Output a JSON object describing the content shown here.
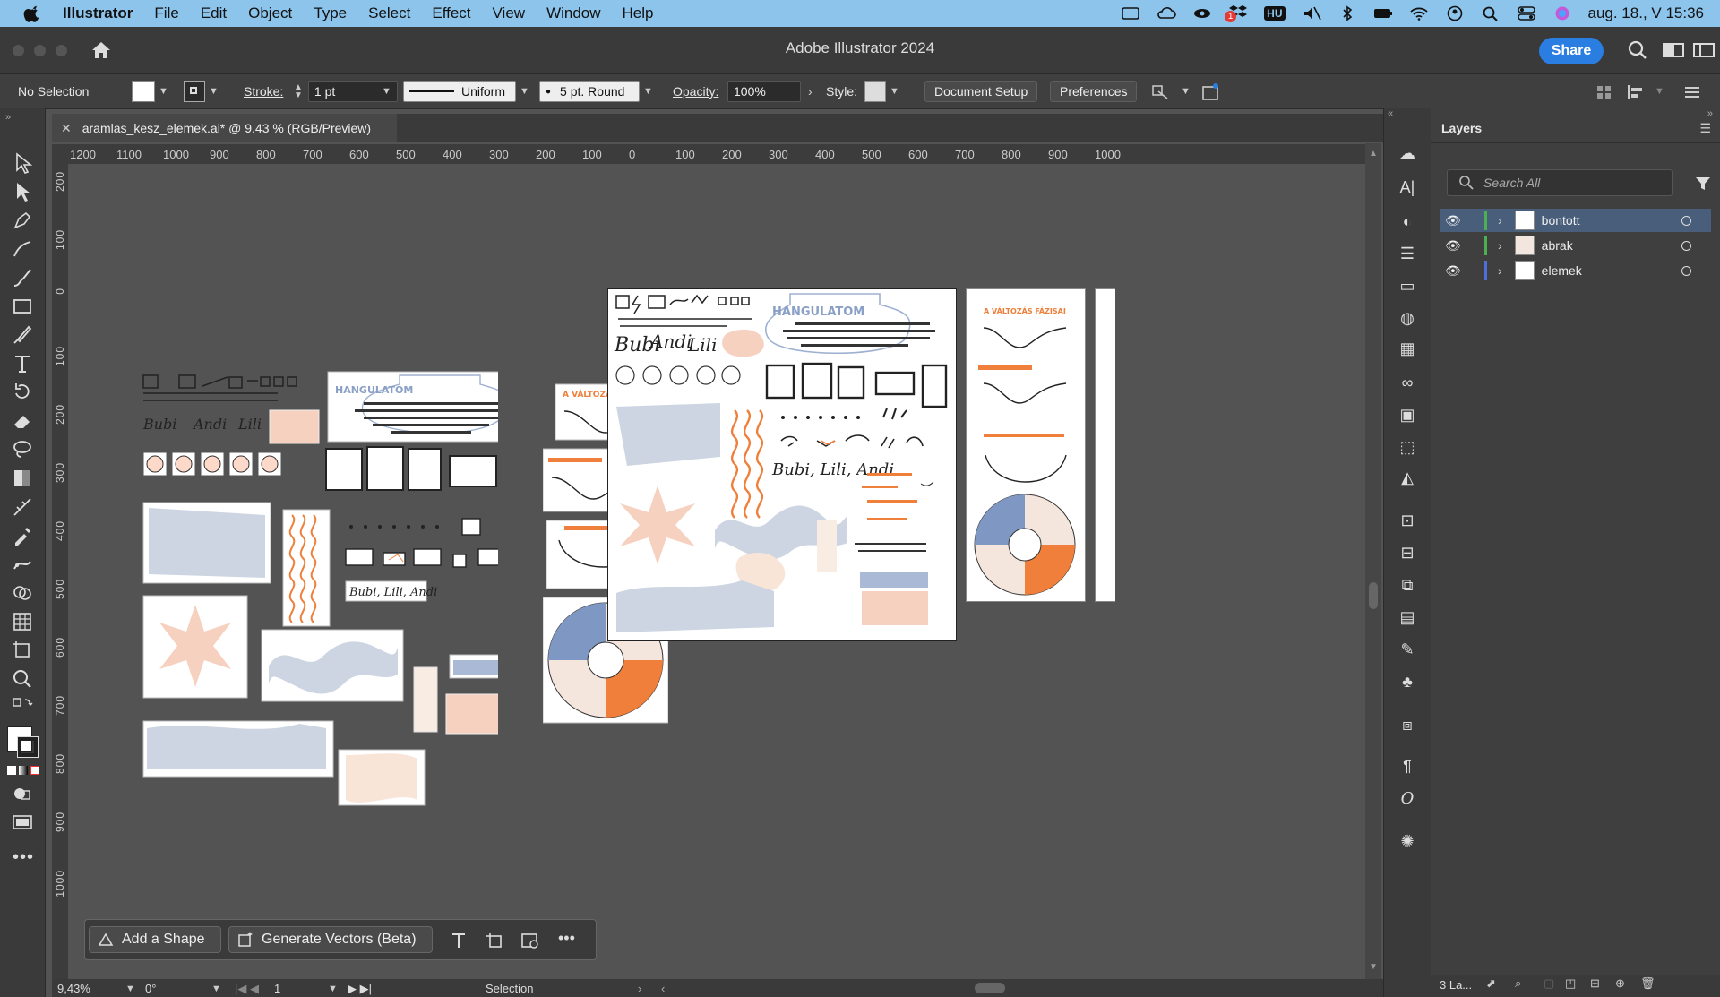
{
  "menubar": {
    "app_name": "Illustrator",
    "items": [
      "File",
      "Edit",
      "Object",
      "Type",
      "Select",
      "Effect",
      "View",
      "Window",
      "Help"
    ],
    "lang_badge": "HU",
    "notification_count": "1",
    "clock": "aug. 18., V  15:36"
  },
  "titlebar": {
    "title": "Adobe Illustrator 2024",
    "share_label": "Share"
  },
  "controlbar": {
    "selection": "No Selection",
    "stroke_label": "Stroke:",
    "stroke_value": "1 pt",
    "profile": "Uniform",
    "brush": "5 pt. Round",
    "opacity_label": "Opacity:",
    "opacity_value": "100%",
    "style_label": "Style:",
    "document_setup": "Document Setup",
    "preferences": "Preferences"
  },
  "document_tab": {
    "label": "aramlas_kesz_elemek.ai* @ 9.43 % (RGB/Preview)"
  },
  "rulers": {
    "horizontal": [
      "1200",
      "1100",
      "1000",
      "900",
      "800",
      "700",
      "600",
      "500",
      "400",
      "300",
      "200",
      "100",
      "0",
      "100",
      "200",
      "300",
      "400",
      "500",
      "600",
      "700",
      "800",
      "900",
      "1000"
    ],
    "vertical": [
      "200",
      "100",
      "0",
      "100",
      "200",
      "300",
      "400",
      "500",
      "600",
      "700",
      "800",
      "900",
      "1000"
    ]
  },
  "canvas": {
    "artboard_text": {
      "hangulatom": "HANGULATOM",
      "valtozas": "A VÁLTOZÁS FÁZISAI",
      "signature": "Bubi, Lili, Andi"
    }
  },
  "layers_panel": {
    "title": "Layers",
    "search_placeholder": "Search All",
    "layers": [
      {
        "name": "bontott",
        "color": "#4caf50",
        "selected": true
      },
      {
        "name": "abrak",
        "color": "#4caf50",
        "selected": false
      },
      {
        "name": "elemek",
        "color": "#4f6fd8",
        "selected": false
      }
    ],
    "count_label": "3 La..."
  },
  "statusbar": {
    "zoom": "9,43%",
    "rotation": "0°",
    "artboard_number": "1",
    "tool_name": "Selection"
  },
  "context_bar": {
    "add_shape": "Add a Shape",
    "generate_vectors": "Generate Vectors (Beta)"
  },
  "colors": {
    "accent_blue": "#2a7de1",
    "peach": "#f6d1c0",
    "light_blue": "#ccd5e1",
    "orange": "#ef7f3a",
    "menubar_bg": "#8cc4ec"
  }
}
